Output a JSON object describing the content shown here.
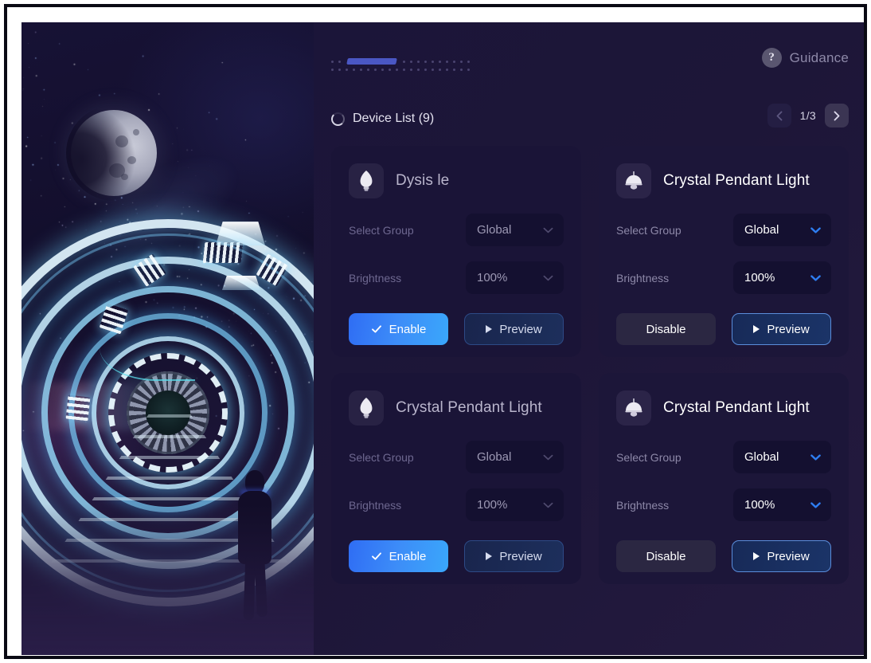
{
  "header": {
    "progress_icon": "dotted-progress-bar",
    "guidance_label": "Guidance",
    "guidance_icon": "question-mark-icon"
  },
  "list_bar": {
    "spinner_icon": "loading-spinner-icon",
    "title": "Device List (9)",
    "page_indicator": "1/3",
    "prev_icon": "chevron-left-icon",
    "next_icon": "chevron-right-icon"
  },
  "labels": {
    "select_group": "Select Group",
    "brightness": "Brightness"
  },
  "icons": {
    "bulb": "light-bulb-icon",
    "pendant": "pendant-lamp-icon",
    "chevron_down": "chevron-down-icon",
    "check": "check-icon",
    "play": "play-triangle-icon"
  },
  "colors": {
    "accent_blue": "#3d8df8",
    "panel_bg": "#1b1539",
    "card_bg": "#1a1437",
    "select_bg": "#141030",
    "text_muted": "#6e6890",
    "text_bright": "#ffffff"
  },
  "artwork": {
    "alt": "sci-fi space tunnel with moon, glowing rings and silhouetted figure"
  },
  "cards": [
    {
      "icon": "bulb",
      "title": "Dysis le",
      "group_label": "Select Group",
      "group_value": "Global",
      "brightness_label": "Brightness",
      "brightness_value": "100%",
      "primary_label": "Enable",
      "primary_state": "enable",
      "preview_label": "Preview",
      "highlighted": false
    },
    {
      "icon": "pendant",
      "title": "Crystal Pendant Light",
      "group_label": "Select Group",
      "group_value": "Global",
      "brightness_label": "Brightness",
      "brightness_value": "100%",
      "primary_label": "Disable",
      "primary_state": "disable",
      "preview_label": "Preview",
      "highlighted": true
    },
    {
      "icon": "bulb",
      "title": "Crystal Pendant Light",
      "group_label": "Select Group",
      "group_value": "Global",
      "brightness_label": "Brightness",
      "brightness_value": "100%",
      "primary_label": "Enable",
      "primary_state": "enable",
      "preview_label": "Preview",
      "highlighted": false
    },
    {
      "icon": "pendant",
      "title": "Crystal Pendant Light",
      "group_label": "Select Group",
      "group_value": "Global",
      "brightness_label": "Brightness",
      "brightness_value": "100%",
      "primary_label": "Disable",
      "primary_state": "disable",
      "preview_label": "Preview",
      "highlighted": true
    }
  ]
}
